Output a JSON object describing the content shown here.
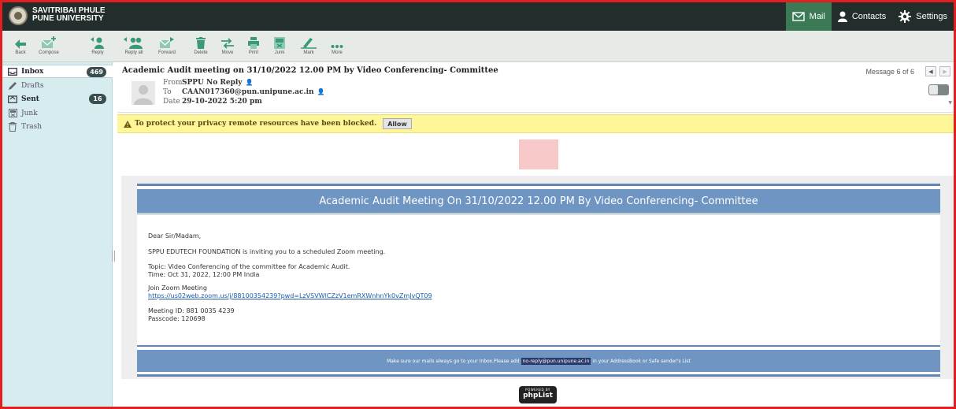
{
  "app": {
    "brand_line1": "SAVITRIBAI PHULE",
    "brand_line2": "PUNE UNIVERSITY",
    "nav": [
      {
        "label": "Mail",
        "icon": "mail-icon"
      },
      {
        "label": "Contacts",
        "icon": "person-icon"
      },
      {
        "label": "Settings",
        "icon": "gear-icon"
      }
    ]
  },
  "toolbar": {
    "back": "Back",
    "compose": "Compose",
    "reply": "Reply",
    "reply_all": "Reply all",
    "forward": "Forward",
    "delete": "Delete",
    "move": "Move",
    "print": "Print",
    "junk": "Junk",
    "mark": "Mark",
    "more": "More"
  },
  "sidebar": {
    "items": [
      {
        "label": "Inbox",
        "badge": "469",
        "icon": "inbox-icon"
      },
      {
        "label": "Drafts",
        "badge": "",
        "icon": "pencil-icon"
      },
      {
        "label": "Sent",
        "badge": "16",
        "icon": "sent-icon"
      },
      {
        "label": "Junk",
        "badge": "",
        "icon": "junk-icon"
      },
      {
        "label": "Trash",
        "badge": "",
        "icon": "trash-icon"
      }
    ]
  },
  "message": {
    "subject": "Academic Audit meeting on 31/10/2022 12.00 PM by Video Conferencing- Committee",
    "from_label": "From",
    "from_value": "SPPU No Reply",
    "to_label": "To",
    "to_value": "CAAN017360@pun.unipune.ac.in",
    "date_label": "Date",
    "date_value": "29-10-2022 5:20 pm",
    "counter": "Message 6 of 6"
  },
  "warning": {
    "text": "To protect your privacy remote resources have been blocked.",
    "allow": "Allow"
  },
  "email": {
    "banner": "Academic Audit Meeting On 31/10/2022 12.00 PM By Video Conferencing- Committee",
    "greeting": "Dear Sir/Madam,",
    "invite": "SPPU EDUTECH FOUNDATION is inviting you to a scheduled Zoom meeting.",
    "topic": "Topic: Video Conferencing of the committee for Academic Audit.",
    "time": "Time: Oct 31, 2022, 12:00 PM India",
    "join": "Join Zoom Meeting",
    "link": "https://us02web.zoom.us/j/88100354239?pwd=LzVSVWlCZzV1emRXWnhnYk0vZmJvQT09",
    "meeting_id": "Meeting ID: 881 0035 4239",
    "passcode": "Passcode: 120698",
    "footer_pre": "Make sure our mails always go to your Inbox.Please add",
    "footer_email": "no-reply@pun.unipune.ac.in",
    "footer_post": "in your AddressBook or Safe sender's List",
    "powered_by": "POWERED BY",
    "phplist": "phpList"
  }
}
